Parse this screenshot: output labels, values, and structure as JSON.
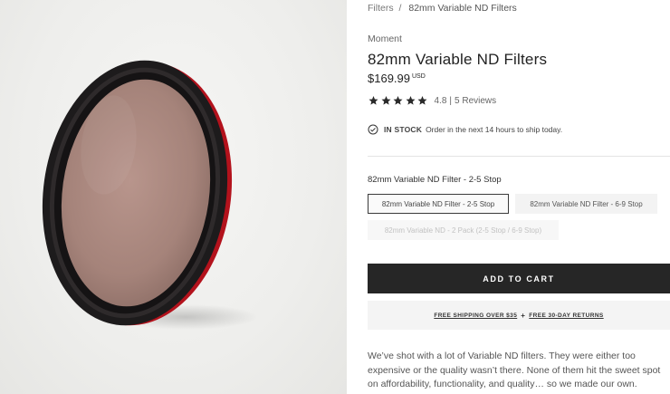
{
  "breadcrumb": {
    "parent": "Filters",
    "separator": "/",
    "current": "82mm Variable ND Filters"
  },
  "product": {
    "brand": "Moment",
    "title": "82mm Variable ND Filters",
    "price": "$169.99",
    "currency": "USD",
    "rating": {
      "score": "4.8",
      "stars": 5,
      "separator": "|",
      "reviews": "5 Reviews"
    },
    "stock": {
      "status": "IN STOCK",
      "message": "Order in the next 14 hours to ship today."
    }
  },
  "options": {
    "label": "82mm Variable ND Filter - 2-5 Stop",
    "variants": [
      {
        "label": "82mm Variable ND Filter - 2-5 Stop",
        "state": "selected"
      },
      {
        "label": "82mm Variable ND Filter - 6-9 Stop",
        "state": "available"
      },
      {
        "label": "82mm Variable ND - 2 Pack (2-5 Stop / 6-9 Stop)",
        "state": "unavailable"
      }
    ]
  },
  "cart": {
    "add_label": "ADD TO CART"
  },
  "shipping": {
    "free_shipping": "FREE SHIPPING OVER $35",
    "plus": "+",
    "returns": "FREE 30-DAY RETURNS"
  },
  "description": "We’ve shot with a lot of Variable ND filters. They were either too expensive or the quality wasn’t there. None of them hit the sweet spot on affordability, functionality, and quality… so we made our own.",
  "icons": {
    "star": "star-icon",
    "stock": "check-circle-icon"
  },
  "colors": {
    "cart_bg": "#262626",
    "filter_glass": "#a9877d",
    "filter_ring": "#1d1b1c",
    "accent_red": "#b3121c"
  }
}
